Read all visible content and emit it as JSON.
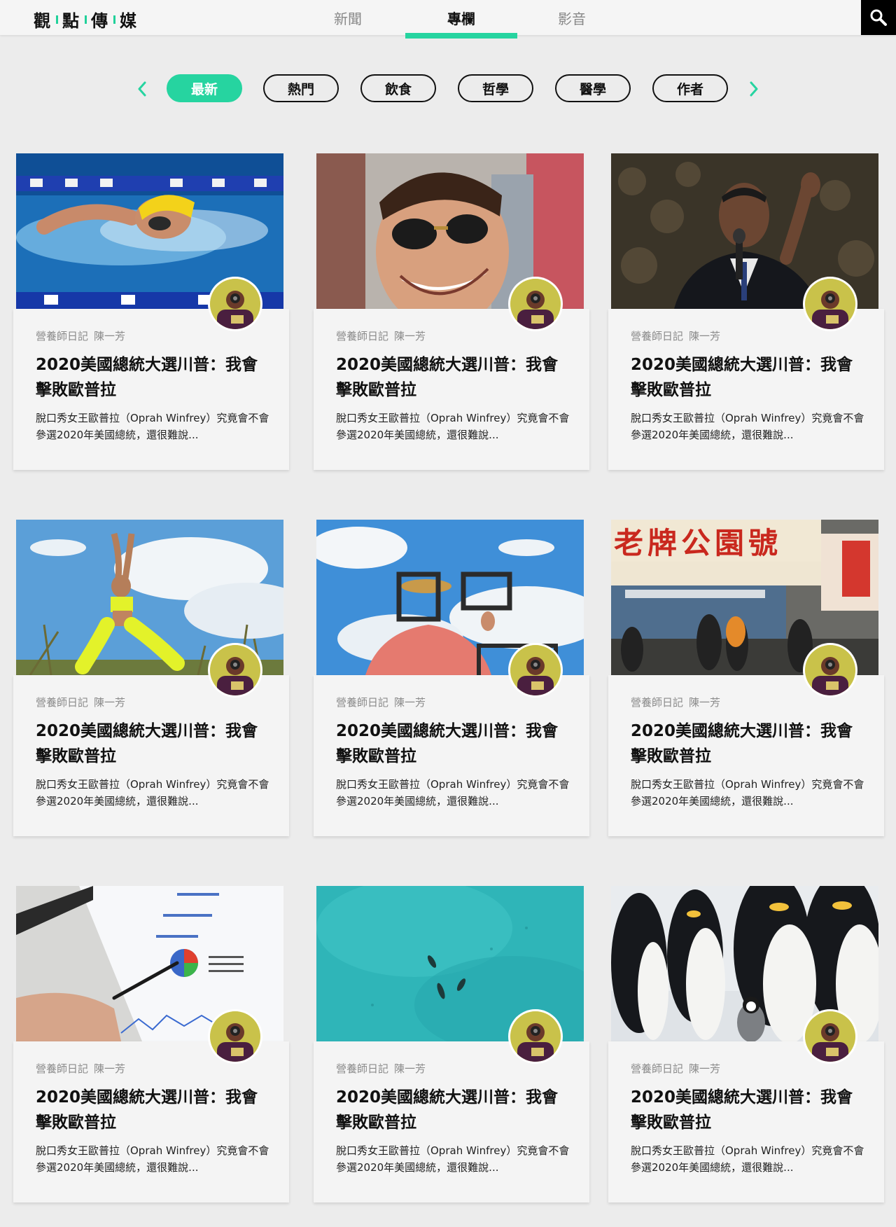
{
  "header": {
    "logo_chars": [
      "觀",
      "點",
      "傳",
      "媒"
    ],
    "nav": [
      {
        "label": "新聞",
        "active": false
      },
      {
        "label": "專欄",
        "active": true
      },
      {
        "label": "影音",
        "active": false
      }
    ],
    "search_icon": "search-icon"
  },
  "filters": {
    "prev_icon": "chevron-left-icon",
    "next_icon": "chevron-right-icon",
    "items": [
      {
        "label": "最新",
        "active": true
      },
      {
        "label": "熱門",
        "active": false
      },
      {
        "label": "飲食",
        "active": false
      },
      {
        "label": "哲學",
        "active": false
      },
      {
        "label": "醫學",
        "active": false
      },
      {
        "label": "作者",
        "active": false
      }
    ]
  },
  "colors": {
    "accent": "#26d4a0",
    "background": "#ececec",
    "card": "#f4f4f4"
  },
  "articles": [
    {
      "image": "swimmer-photo",
      "column": "營養師日記",
      "author": "陳一芳",
      "title": "2020美國總統大選川普：我會擊敗歐普拉",
      "excerpt": "脫口秀女王歐普拉（Oprah Winfrey）究竟會不會參選2020年美國總統，還很難說..."
    },
    {
      "image": "man-sunglasses-photo",
      "column": "營養師日記",
      "author": "陳一芳",
      "title": "2020美國總統大選川普：我會擊敗歐普拉",
      "excerpt": "脫口秀女王歐普拉（Oprah Winfrey）究竟會不會參選2020年美國總統，還很難說..."
    },
    {
      "image": "speaker-microphone-photo",
      "column": "營養師日記",
      "author": "陳一芳",
      "title": "2020美國總統大選川普：我會擊敗歐普拉",
      "excerpt": "脫口秀女王歐普拉（Oprah Winfrey）究竟會不會參選2020年美國總統，還很難說..."
    },
    {
      "image": "yoga-woman-photo",
      "column": "營養師日記",
      "author": "陳一芳",
      "title": "2020美國總統大選川普：我會擊敗歐普拉",
      "excerpt": "脫口秀女王歐普拉（Oprah Winfrey）究竟會不會參選2020年美國總統，還很難說..."
    },
    {
      "image": "frames-sky-photo",
      "column": "營養師日記",
      "author": "陳一芳",
      "title": "2020美國總統大選川普：我會擊敗歐普拉",
      "excerpt": "脫口秀女王歐普拉（Oprah Winfrey）究竟會不會參選2020年美國總統，還很難說..."
    },
    {
      "image": "shop-sign-photo",
      "sign_text": "老牌公園號",
      "column": "營養師日記",
      "author": "陳一芳",
      "title": "2020美國總統大選川普：我會擊敗歐普拉",
      "excerpt": "脫口秀女王歐普拉（Oprah Winfrey）究竟會不會參選2020年美國總統，還很難說..."
    },
    {
      "image": "tablet-chart-photo",
      "column": "營養師日記",
      "author": "陳一芳",
      "title": "2020美國總統大選川普：我會擊敗歐普拉",
      "excerpt": "脫口秀女王歐普拉（Oprah Winfrey）究竟會不會參選2020年美國總統，還很難說..."
    },
    {
      "image": "ocean-swimmers-photo",
      "column": "營養師日記",
      "author": "陳一芳",
      "title": "2020美國總統大選川普：我會擊敗歐普拉",
      "excerpt": "脫口秀女王歐普拉（Oprah Winfrey）究竟會不會參選2020年美國總統，還很難說..."
    },
    {
      "image": "penguins-photo",
      "column": "營養師日記",
      "author": "陳一芳",
      "title": "2020美國總統大選川普：我會擊敗歐普拉",
      "excerpt": "脫口秀女王歐普拉（Oprah Winfrey）究竟會不會參選2020年美國總統，還很難說..."
    }
  ]
}
